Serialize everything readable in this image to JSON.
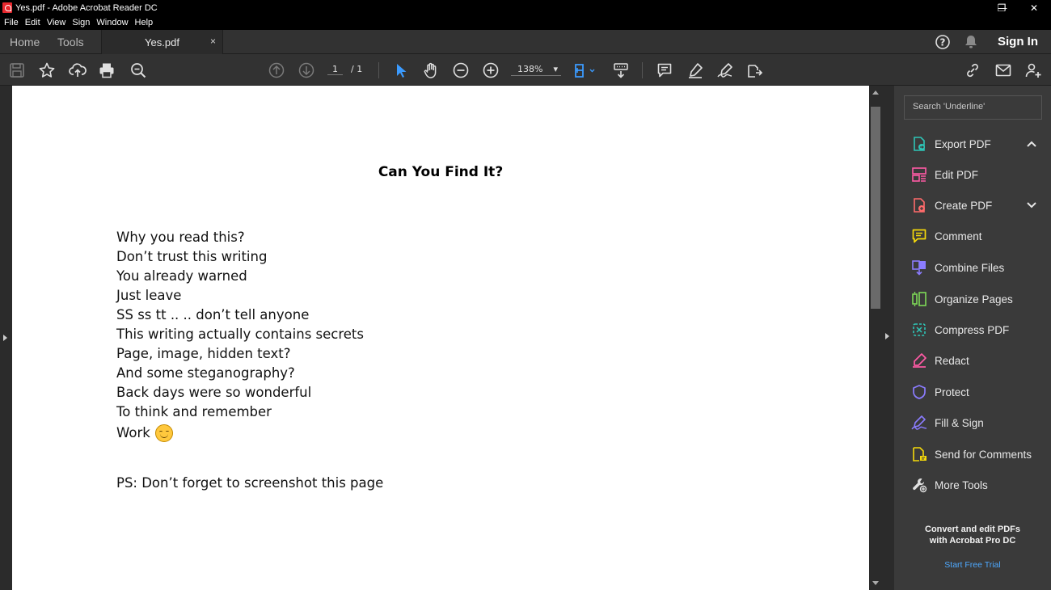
{
  "window": {
    "title": "Yes.pdf - Adobe Acrobat Reader DC",
    "controls": [
      "—",
      "❐",
      "✕"
    ]
  },
  "menu": [
    "File",
    "Edit",
    "View",
    "Sign",
    "Window",
    "Help"
  ],
  "tabs": {
    "home": "Home",
    "tools": "Tools",
    "document": "Yes.pdf",
    "close_symbol": "×"
  },
  "header": {
    "sign_in": "Sign In",
    "icons": [
      "help-icon",
      "bell-icon"
    ]
  },
  "toolbar": {
    "page_current": "1",
    "page_total": "/ 1",
    "zoom": "138%",
    "zoom_caret": "▾",
    "icons": [
      "save-icon",
      "bookmark-star-icon",
      "upload-cloud-icon",
      "print-icon",
      "zoom-search-icon",
      "page-up-icon",
      "page-down-icon",
      "select-pointer-icon",
      "hand-icon",
      "zoom-out-icon",
      "zoom-in-icon",
      "fit-page-icon",
      "scroll-mode-icon",
      "comment-icon",
      "highlight-pen-icon",
      "sign-icon",
      "share-icon",
      "link-icon",
      "mail-icon",
      "add-user-icon"
    ]
  },
  "document": {
    "title": "Can You Find It?",
    "lines": [
      "Why you read this?",
      "Don’t trust this writing",
      "You already warned",
      "Just leave",
      "SS ss tt .. .. don’t tell anyone",
      "This writing actually contains secrets",
      "Page, image, hidden text?",
      "And some steganography?",
      "Back days were so wonderful",
      "To think and remember"
    ],
    "last_line": "Work",
    "ps": "PS: Don’t forget to screenshot this page"
  },
  "right_panel": {
    "search_placeholder": "Search 'Underline'",
    "tools": [
      {
        "label": "Export PDF",
        "icon": "export-pdf-icon",
        "color": "#2ec4b6"
      },
      {
        "label": "Edit PDF",
        "icon": "edit-pdf-icon",
        "color": "#ff5aa5"
      },
      {
        "label": "Create PDF",
        "icon": "create-pdf-icon",
        "color": "#ff6b6b"
      },
      {
        "label": "Comment",
        "icon": "comment-tool-icon",
        "color": "#f5d90a"
      },
      {
        "label": "Combine Files",
        "icon": "combine-files-icon",
        "color": "#8b7cff"
      },
      {
        "label": "Organize Pages",
        "icon": "organize-pages-icon",
        "color": "#7ed957"
      },
      {
        "label": "Compress PDF",
        "icon": "compress-pdf-icon",
        "color": "#2ec4b6"
      },
      {
        "label": "Redact",
        "icon": "redact-icon",
        "color": "#ff5aa5"
      },
      {
        "label": "Protect",
        "icon": "protect-shield-icon",
        "color": "#8b7cff"
      },
      {
        "label": "Fill & Sign",
        "icon": "fill-sign-icon",
        "color": "#8b7cff"
      },
      {
        "label": "Send for Comments",
        "icon": "send-comments-icon",
        "color": "#f5d90a"
      },
      {
        "label": "More Tools",
        "icon": "more-tools-icon",
        "color": "#e0e0e0"
      }
    ],
    "promo": "Convert and edit PDFs with Acrobat Pro DC",
    "trial": "Start Free Trial"
  }
}
